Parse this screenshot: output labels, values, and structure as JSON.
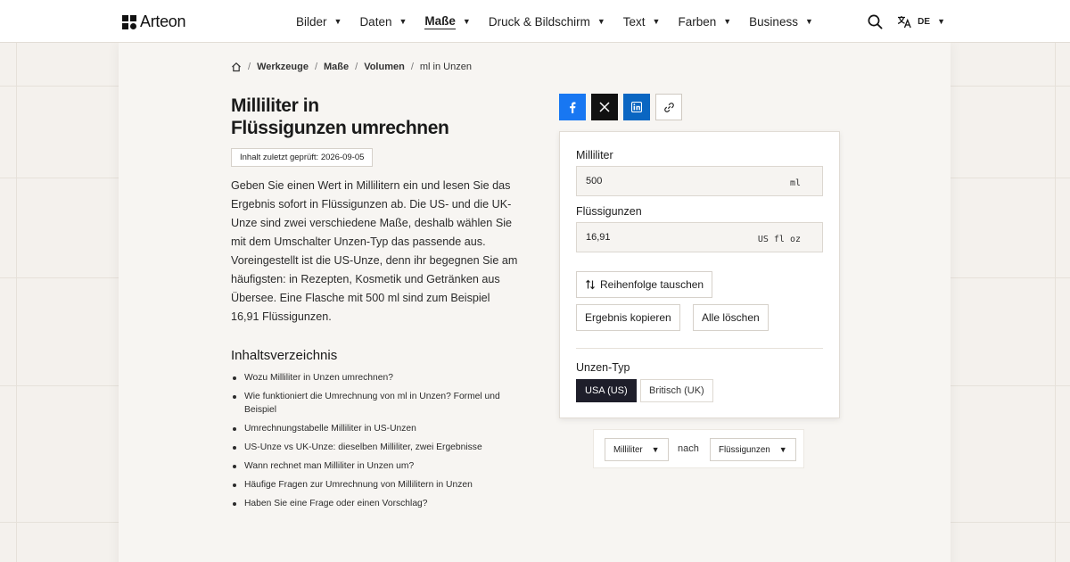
{
  "brand": {
    "name": "Arteon"
  },
  "nav": {
    "items": [
      {
        "label": "Bilder",
        "active": false
      },
      {
        "label": "Daten",
        "active": false
      },
      {
        "label": "Maße",
        "active": true
      },
      {
        "label": "Druck & Bildschirm",
        "active": false
      },
      {
        "label": "Text",
        "active": false
      },
      {
        "label": "Farben",
        "active": false
      },
      {
        "label": "Business",
        "active": false
      }
    ],
    "caret": "▼"
  },
  "header": {
    "language": "DE"
  },
  "breadcrumb": {
    "items": [
      "Werkzeuge",
      "Maße",
      "Volumen"
    ],
    "current": "ml in Unzen",
    "separator": "/"
  },
  "page": {
    "title_line1": "Milliliter in",
    "title_line2": "Flüssigunzen umrechnen",
    "review_badge": "Inhalt zuletzt geprüft: 2026-09-05",
    "intro": "Geben Sie einen Wert in Millilitern ein und lesen Sie das Ergebnis sofort in Flüssigunzen ab. Die US- und die UK-Unze sind zwei verschiedene Maße, deshalb wählen Sie mit dem Umschalter Unzen-Typ das passende aus. Voreingestellt ist die US-Unze, denn ihr begegnen Sie am häufigsten: in Rezepten, Kosmetik und Getränken aus Übersee. Eine Flasche mit 500 ml sind zum Beispiel 16,91 Flüssigunzen."
  },
  "toc": {
    "title": "Inhaltsverzeichnis",
    "items": [
      "Wozu Milliliter in Unzen umrechnen?",
      "Wie funktioniert die Umrechnung von ml in Unzen? Formel und Beispiel",
      "Umrechnungstabelle Milliliter in US-Unzen",
      "US-Unze vs UK-Unze: dieselben Milliliter, zwei Ergebnisse",
      "Wann rechnet man Milliliter in Unzen um?",
      "Häufige Fragen zur Umrechnung von Millilitern in Unzen",
      "Haben Sie eine Frage oder einen Vorschlag?"
    ]
  },
  "converter": {
    "from_label": "Milliliter",
    "from_value": "500",
    "from_unit": "ml",
    "to_label": "Flüssigunzen",
    "to_value": "16,91",
    "to_unit": "US fl oz",
    "swap_label": "Reihenfolge tauschen",
    "copy_label": "Ergebnis kopieren",
    "clear_label": "Alle löschen",
    "unit_type_label": "Unzen-Typ",
    "unit_type_options": [
      "USA (US)",
      "Britisch (UK)"
    ],
    "unit_type_selected": "USA (US)"
  },
  "selector": {
    "from": "Milliliter",
    "connector": "nach",
    "to": "Flüssigunzen"
  },
  "colors": {
    "background": "#f4f1ed",
    "card": "#f7f5f2",
    "facebook": "#1877f2",
    "x": "#111111",
    "linkedin": "#0a66c2",
    "toggle_active": "#1e1e2a"
  },
  "icons": [
    "home-icon",
    "facebook-icon",
    "x-icon",
    "linkedin-icon",
    "link-icon",
    "search-icon",
    "translate-icon",
    "swap-icon"
  ]
}
